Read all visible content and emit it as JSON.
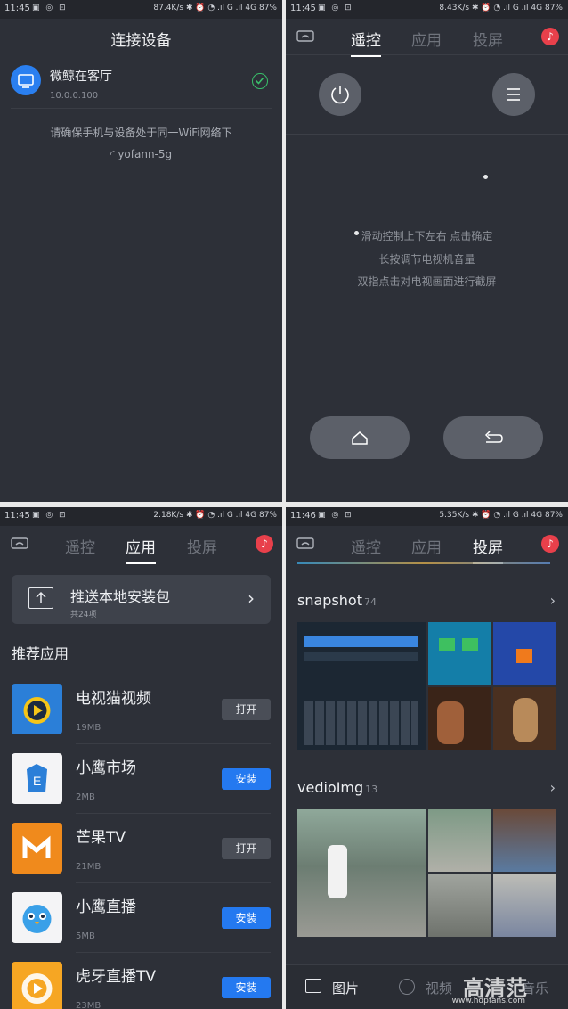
{
  "status_bars": [
    {
      "time": "11:45",
      "speed": "87.4K/s",
      "battery": "87%"
    },
    {
      "time": "11:45",
      "speed": "8.43K/s",
      "battery": "87%"
    },
    {
      "time": "11:45",
      "speed": "2.18K/s",
      "battery": "87%"
    },
    {
      "time": "11:46",
      "speed": "5.35K/s",
      "battery": "87%"
    }
  ],
  "status_icons_left": "▣ ◎ ⊡",
  "status_icons_right": "✱ ⏰ ◔ .ıl G .ıl 4G",
  "connect": {
    "title": "连接设备",
    "device_name": "微鲸在客厅",
    "device_ip": "10.0.0.100",
    "note": "请确保手机与设备处于同一WiFi网络下",
    "ssid": "yofann-5g"
  },
  "tabs": [
    "遥控",
    "应用",
    "投屏"
  ],
  "remote": {
    "hints": [
      "滑动控制上下左右 点击确定",
      "长按调节电视机音量",
      "双指点击对电视画面进行截屏"
    ]
  },
  "apps": {
    "push_title": "推送本地安装包",
    "push_sub": "共24项",
    "rec_title": "推荐应用",
    "list": [
      {
        "name": "电视猫视频",
        "size": "19MB",
        "action": "打开",
        "color": "#2b7fd8"
      },
      {
        "name": "小鹰市场",
        "size": "2MB",
        "action": "安装",
        "color": "#f4f4f6"
      },
      {
        "name": "芒果TV",
        "size": "21MB",
        "action": "打开",
        "color": "#f08a1c"
      },
      {
        "name": "小鹰直播",
        "size": "5MB",
        "action": "安装",
        "color": "#f4f4f6"
      },
      {
        "name": "虎牙直播TV",
        "size": "23MB",
        "action": "安装",
        "color": "#f6a623"
      }
    ]
  },
  "cast": {
    "albums": [
      {
        "name": "snapshot",
        "count": "74"
      },
      {
        "name": "vedioImg",
        "count": "13"
      }
    ],
    "bottom": [
      "图片",
      "视频",
      "音乐"
    ],
    "watermark": "高清范",
    "watermark_url": "www.hdpfans.com"
  }
}
